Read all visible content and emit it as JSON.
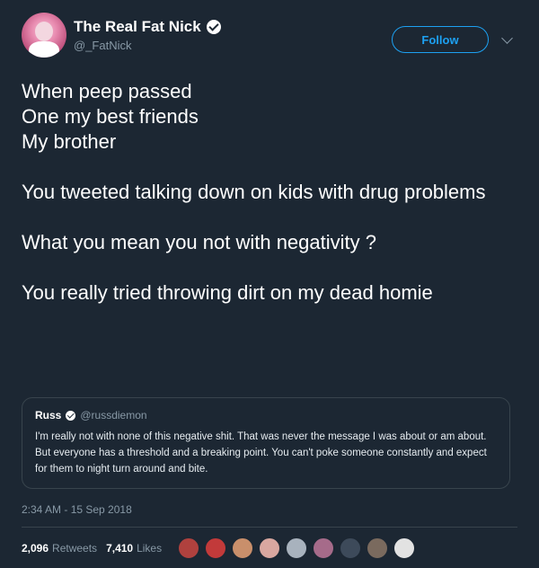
{
  "user": {
    "display_name": "The Real Fat Nick",
    "handle": "@_FatNick",
    "follow_label": "Follow"
  },
  "tweet": {
    "paragraphs": [
      [
        "When peep passed",
        "One my best friends",
        "My brother"
      ],
      [
        "You tweeted talking down on kids with drug problems"
      ],
      [
        "What you mean you not with negativity ?"
      ],
      [
        "You really tried throwing dirt on my dead homie"
      ]
    ]
  },
  "quoted_tweet": {
    "name": "Russ",
    "handle": "@russdiemon",
    "text": "I'm really not with none of this negative shit. That was never the message I was about or am about. But everyone has a threshold and a breaking point. You can't poke someone constantly and expect for them to night turn around and bite."
  },
  "timestamp": "2:34 AM - 15 Sep 2018",
  "stats": {
    "retweets_count": "2,096",
    "retweets_label": "Retweets",
    "likes_count": "7,410",
    "likes_label": "Likes"
  },
  "likers": [
    {
      "color": "#b0413e"
    },
    {
      "color": "#c23a3a"
    },
    {
      "color": "#c98f6b"
    },
    {
      "color": "#d9a7a0"
    },
    {
      "color": "#a8b2bd"
    },
    {
      "color": "#a66b8a"
    },
    {
      "color": "#3d4a5a"
    },
    {
      "color": "#7a6a5e"
    },
    {
      "color": "#e2e2e2"
    }
  ],
  "colors": {
    "background": "#1c2733",
    "accent": "#1da1f2",
    "muted": "#8899a6"
  }
}
